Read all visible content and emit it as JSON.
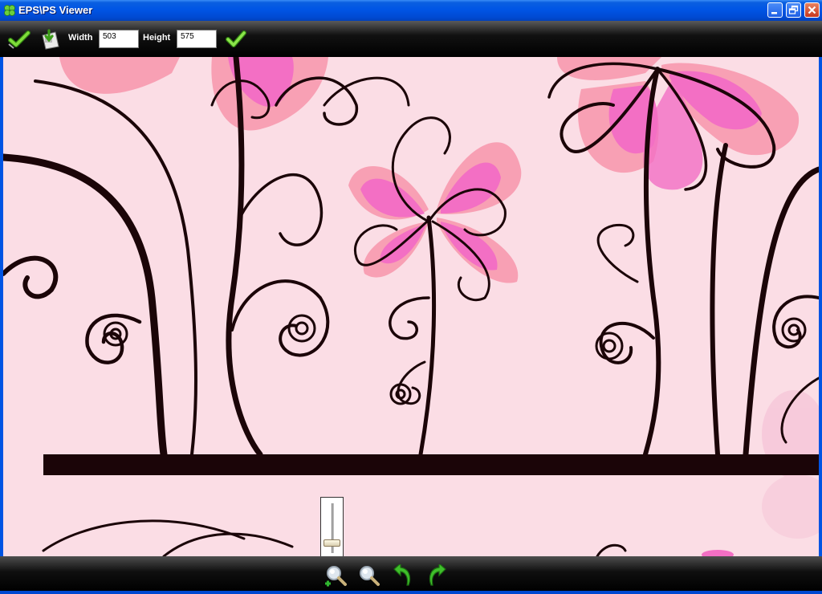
{
  "window": {
    "title": "EPS\\PS Viewer",
    "icons": {
      "app": "clover-icon",
      "minimize": "minimize-icon",
      "maximize": "restore-icon",
      "close": "close-icon"
    }
  },
  "toolbar": {
    "apply_icon": "check-icon",
    "save_icon": "save-icon",
    "width_label": "Width",
    "width_value": "503",
    "height_label": "Height",
    "height_value": "575",
    "confirm_icon": "check-icon"
  },
  "zoom": {
    "level_fraction": 0.1
  },
  "bottombar": {
    "zoom_in_icon": "zoom-in-icon",
    "zoom_out_icon": "zoom-out-icon",
    "rotate_left_icon": "rotate-left-icon",
    "rotate_right_icon": "rotate-right-icon"
  },
  "colors": {
    "canvas_bg": "#fbdde5",
    "petal_pink": "#f36fc4",
    "petal_light": "#f8a0b4",
    "stem": "#1b0508"
  }
}
